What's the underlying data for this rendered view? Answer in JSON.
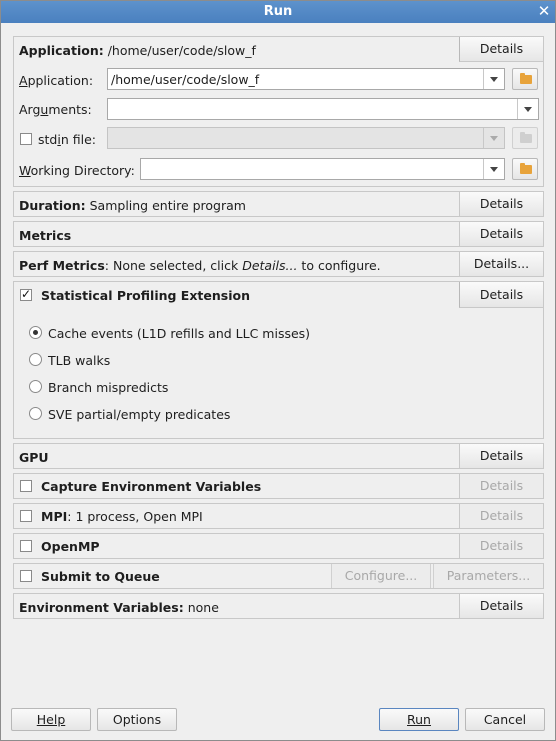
{
  "window": {
    "title": "Run"
  },
  "application_panel": {
    "header_label": "Application:",
    "header_value": "/home/user/code/slow_f",
    "details_label": "Details",
    "application_label": "Application:",
    "application_value": "/home/user/code/slow_f",
    "arguments_label": "Arguments:",
    "arguments_value": "",
    "stdin_label": "stdin file:",
    "stdin_checked": false,
    "stdin_value": "",
    "workdir_label": "Working Directory:",
    "workdir_value": ""
  },
  "duration_panel": {
    "label": "Duration:",
    "value": "Sampling entire program",
    "details_label": "Details"
  },
  "metrics_panel": {
    "label": "Metrics",
    "details_label": "Details"
  },
  "perf_metrics_panel": {
    "label": "Perf Metrics",
    "value_pre": ": None selected, click ",
    "value_italic": "Details...",
    "value_post": " to configure.",
    "details_label": "Details..."
  },
  "spe_panel": {
    "label": "Statistical Profiling Extension",
    "checked": true,
    "details_label": "Details",
    "options": [
      {
        "label": "Cache events (L1D refills and LLC misses)",
        "selected": true
      },
      {
        "label": "TLB walks",
        "selected": false
      },
      {
        "label": "Branch mispredicts",
        "selected": false
      },
      {
        "label": "SVE partial/empty predicates",
        "selected": false
      }
    ]
  },
  "gpu_panel": {
    "label": "GPU",
    "details_label": "Details"
  },
  "capture_env_panel": {
    "label": "Capture Environment Variables",
    "checked": false,
    "details_label": "Details"
  },
  "mpi_panel": {
    "label": "MPI",
    "value": ": 1 process, Open MPI",
    "checked": false,
    "details_label": "Details"
  },
  "openmp_panel": {
    "label": "OpenMP",
    "checked": false,
    "details_label": "Details"
  },
  "queue_panel": {
    "label": "Submit to Queue",
    "checked": false,
    "configure_label": "Configure...",
    "parameters_label": "Parameters..."
  },
  "env_vars_panel": {
    "label": "Environment Variables:",
    "value": "none",
    "details_label": "Details"
  },
  "footer": {
    "help_label": "Help",
    "options_label": "Options",
    "run_label": "Run",
    "cancel_label": "Cancel"
  },
  "colors": {
    "titlebar": "#4f86c6",
    "background": "#efefef",
    "disabled_text": "#a8a8a8",
    "folder_icon": "#e8a33a"
  }
}
